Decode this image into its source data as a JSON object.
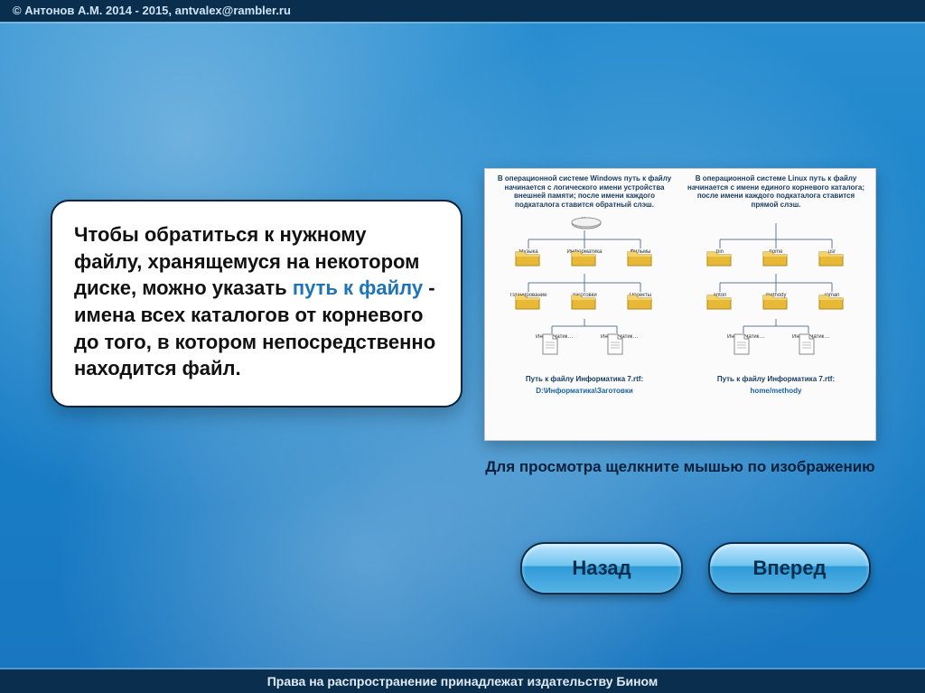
{
  "header": {
    "copyright": "© Антонов А.М. 2014 - 2015, antvalex@rambler.ru"
  },
  "footer": {
    "rights": "Права на распространение принадлежат издательству Бином"
  },
  "card": {
    "text_before": "Чтобы обратиться к нужному файлу, хранящемуся на некотором диске, можно указать ",
    "keyword": "путь к файлу",
    "text_after": " - имена всех каталогов от корневого до того, в котором непосредственно находится файл."
  },
  "viewer": {
    "caption": "Для просмотра щелкните мышью по изображению"
  },
  "diagram": {
    "left": {
      "title": "В операционной системе Windows путь к файлу начинается с логического имени устройства внешней памяти; после имени каждого подкаталога ставится обратный слэш.",
      "root_label": "D:",
      "row1": [
        "Музыка",
        "Информатика",
        "Фильмы"
      ],
      "row2": [
        "Планирование",
        "Заготовки",
        "Проекты"
      ],
      "files": [
        "Информатика 7.rtf",
        "Информатика 8.rtf"
      ],
      "path_label": "Путь к файлу Информатика 7.rtf:",
      "path_value": "D:\\Информатика\\Заготовки"
    },
    "right": {
      "title": "В операционной системе Linux путь к файлу начинается с имени единого корневого каталога; после имени каждого подкаталога ставится прямой слэш.",
      "row1": [
        "bin",
        "home",
        "usr"
      ],
      "row2": [
        "anton",
        "methody",
        "roman"
      ],
      "files": [
        "Информатика 7.rtf",
        "Информатика 8.rtf"
      ],
      "path_label": "Путь к файлу Информатика 7.rtf:",
      "path_value": "home/methody"
    }
  },
  "buttons": {
    "back": "Назад",
    "forward": "Вперед"
  }
}
